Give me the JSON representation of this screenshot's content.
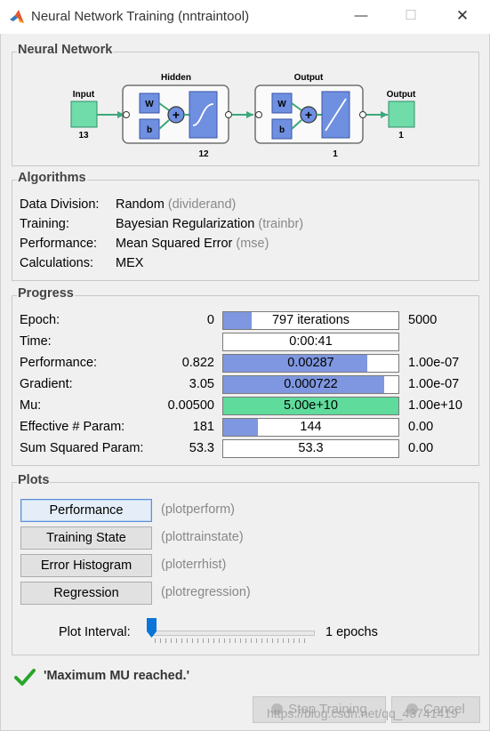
{
  "window": {
    "title": "Neural Network Training (nntraintool)",
    "minimize_icon": "minimize-icon",
    "maximize_icon": "maximize-icon",
    "close_icon": "close-icon"
  },
  "network": {
    "title": "Neural Network",
    "input_label": "Input",
    "input_size": "13",
    "hidden_label": "Hidden",
    "hidden_size": "12",
    "output_layer_label": "Output",
    "output_layer_size": "1",
    "output_label": "Output",
    "output_size": "1",
    "weight_label": "W",
    "bias_label": "b",
    "sum_symbol": "+"
  },
  "algorithms": {
    "title": "Algorithms",
    "rows": [
      {
        "label": "Data Division:",
        "value": "Random",
        "fn": "(dividerand)"
      },
      {
        "label": "Training:",
        "value": "Bayesian Regularization",
        "fn": "(trainbr)"
      },
      {
        "label": "Performance:",
        "value": "Mean Squared Error",
        "fn": "(mse)"
      },
      {
        "label": "Calculations:",
        "value": "MEX",
        "fn": ""
      }
    ]
  },
  "progress": {
    "title": "Progress",
    "rows": [
      {
        "label": "Epoch:",
        "start": "0",
        "bar_text": "797 iterations",
        "end": "5000",
        "fill": 0.16,
        "fill_color": "#7f97e0"
      },
      {
        "label": "Time:",
        "start": "",
        "bar_text": "0:00:41",
        "end": "",
        "fill": 0,
        "fill_color": "#7f97e0"
      },
      {
        "label": "Performance:",
        "start": "0.822",
        "bar_text": "0.00287",
        "end": "1.00e-07",
        "fill": 0.82,
        "fill_color": "#7f97e0"
      },
      {
        "label": "Gradient:",
        "start": "3.05",
        "bar_text": "0.000722",
        "end": "1.00e-07",
        "fill": 0.92,
        "fill_color": "#7f97e0"
      },
      {
        "label": "Mu:",
        "start": "0.00500",
        "bar_text": "5.00e+10",
        "end": "1.00e+10",
        "fill": 1.0,
        "fill_color": "#5fdc9c"
      },
      {
        "label": "Effective # Param:",
        "start": "181",
        "bar_text": "144",
        "end": "0.00",
        "fill": 0.2,
        "fill_color": "#7f97e0"
      },
      {
        "label": "Sum Squared Param:",
        "start": "53.3",
        "bar_text": "53.3",
        "end": "0.00",
        "fill": 0,
        "fill_color": "#7f97e0"
      }
    ]
  },
  "plots": {
    "title": "Plots",
    "buttons": [
      {
        "label": "Performance",
        "fn": "(plotperform)"
      },
      {
        "label": "Training State",
        "fn": "(plottrainstate)"
      },
      {
        "label": "Error Histogram",
        "fn": "(ploterrhist)"
      },
      {
        "label": "Regression",
        "fn": "(plotregression)"
      }
    ],
    "interval_label": "Plot Interval:",
    "interval_value": "1 epochs",
    "interval_slider": 0.0
  },
  "status": {
    "icon": "check-icon",
    "message": "'Maximum MU reached.'"
  },
  "footer": {
    "stop_training_label": "Stop Training",
    "cancel_label": "Cancel",
    "watermark": "https://blog.csdn.net/qq_43741419"
  },
  "colors": {
    "layer_box": "#6f8fe0",
    "io_box": "#6fdcaa",
    "connector": "#3aa87a",
    "mu_fill": "#5fdc9c",
    "bar_fill": "#7f97e0"
  }
}
